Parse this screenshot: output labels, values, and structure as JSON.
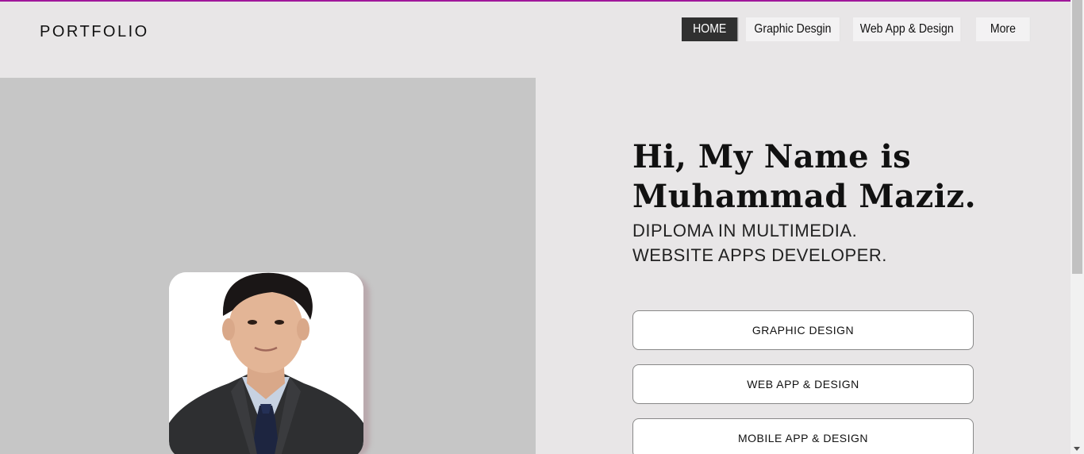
{
  "header": {
    "logo": "PORTFOLIO",
    "nav": [
      {
        "label": "HOME",
        "active": true
      },
      {
        "label": "Graphic Desgin",
        "active": false
      },
      {
        "label": "Web App & Design",
        "active": false
      },
      {
        "label": "More",
        "active": false
      }
    ]
  },
  "hero": {
    "title_line1": "Hi, My Name is",
    "title_line2": "Muhammad Maziz.",
    "sub_line1": "DIPLOMA IN MULTIMEDIA.",
    "sub_line2": "WEBSITE APPS DEVELOPER."
  },
  "buttons": {
    "graphic": "GRAPHIC DESIGN",
    "webapp": "WEB APP & DESIGN",
    "mobile": "MOBILE APP & DESIGN"
  },
  "colors": {
    "accent": "#a0179b",
    "background": "#e8e6e7",
    "panel": "#c6c6c6",
    "nav_active": "#303030"
  }
}
